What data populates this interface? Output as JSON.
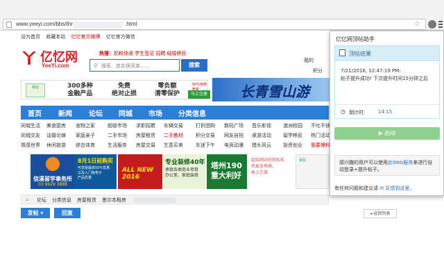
{
  "browser": {
    "url_prefix": "www.yeeyi.com/bbs/thread",
    "url_suffix": ".html"
  },
  "site": {
    "toplinks": [
      "设为首页",
      "收藏本站",
      "亿忆官方微博",
      "亿忆官方微信"
    ],
    "logo_cn": "亿忆网",
    "logo_en": "YeeYi.com",
    "hot_label": "热搜：",
    "hot_text": "奶粉快递 学生签证 招聘 结婚移民",
    "search_placeholder": "搜索、其实很简单……",
    "search_button": "搜索",
    "right_link1": "我的",
    "right_link2": "积分",
    "ad1": {
      "logo": "易信",
      "col1": "300多种\n金融产品",
      "col2": "免费\n绝对止损",
      "col3": "零负额\n清零保护",
      "pct": "50%存款赠金",
      "btn": "马上注册"
    },
    "ad2_text": "长青雪山游",
    "nav": [
      "首页",
      "新闻",
      "论坛",
      "同城",
      "市场",
      "分类信息"
    ],
    "grid": [
      [
        "同城生活",
        "美食厨房",
        "宠物之家",
        "超级市场",
        "求职招聘",
        "车辆交易",
        "打折团购",
        "数码广场",
        "音乐影视",
        "澳洲校园",
        "不吐不快"
      ],
      [
        "同城交友",
        "谈婚论嫁",
        "家庭亲子",
        "二手市场",
        "房屋租赁",
        "二手教材",
        "积分交易",
        "网友自拍",
        "桌游活动",
        "留学移民",
        "热门活动"
      ],
      [
        "情感世界",
        "休闲旅游",
        "综合体育",
        "生活服务",
        "房屋交易",
        "生意买卖",
        "车迷下午",
        "电竞动漫",
        "猎头风云",
        "投资创业",
        "我要爆料"
      ]
    ],
    "ad3": {
      "title": "信溪留学事务所",
      "sub": "03 9629 3888"
    },
    "ad4": {
      "title": "8月1日前购买",
      "sub": "可享受最高50%优惠\n以及入门级电子\n产品优惠"
    },
    "ad5": "ALL NEW 2016",
    "ad6": {
      "title": "专业装修40年",
      "sub": "承接各类商业项目\n办公室、家庭装修"
    },
    "ad7": "塔州190\n重大利好",
    "ad8": "起始网站轻轻松松\n热爱金秀廊，\n高上已增",
    "ad9": "易信",
    "crumb": [
      "论坛",
      "分类信息",
      "房屋租赁",
      "墨尔本租房"
    ],
    "post_button": "发帖",
    "reply_button": "回复",
    "back_button": "返回列表"
  },
  "popup": {
    "title": "亿忆网顶帖助手",
    "panel_title": "顶帖结果",
    "timestamp": "7/21/2016, 12:47:19 PM:",
    "message": "帖子提升成功! 下次提升时间15分钟之后",
    "countdown_label": "倒计时:",
    "countdown_value": "14:15",
    "start_button": "启动",
    "note_pre": "感兴趣的用户可以使用",
    "note_link": "此Web服务",
    "note_post": "来进行自动登录+提升帖子。",
    "footer_pre": "有任何问题和建议请",
    "footer_link": "反馈到这里。"
  },
  "colors": {
    "brand_red": "#d2232a",
    "nav_blue": "#2c7ed6",
    "panel_info": "#d9edf7",
    "start_green": "#8fcf8f"
  }
}
